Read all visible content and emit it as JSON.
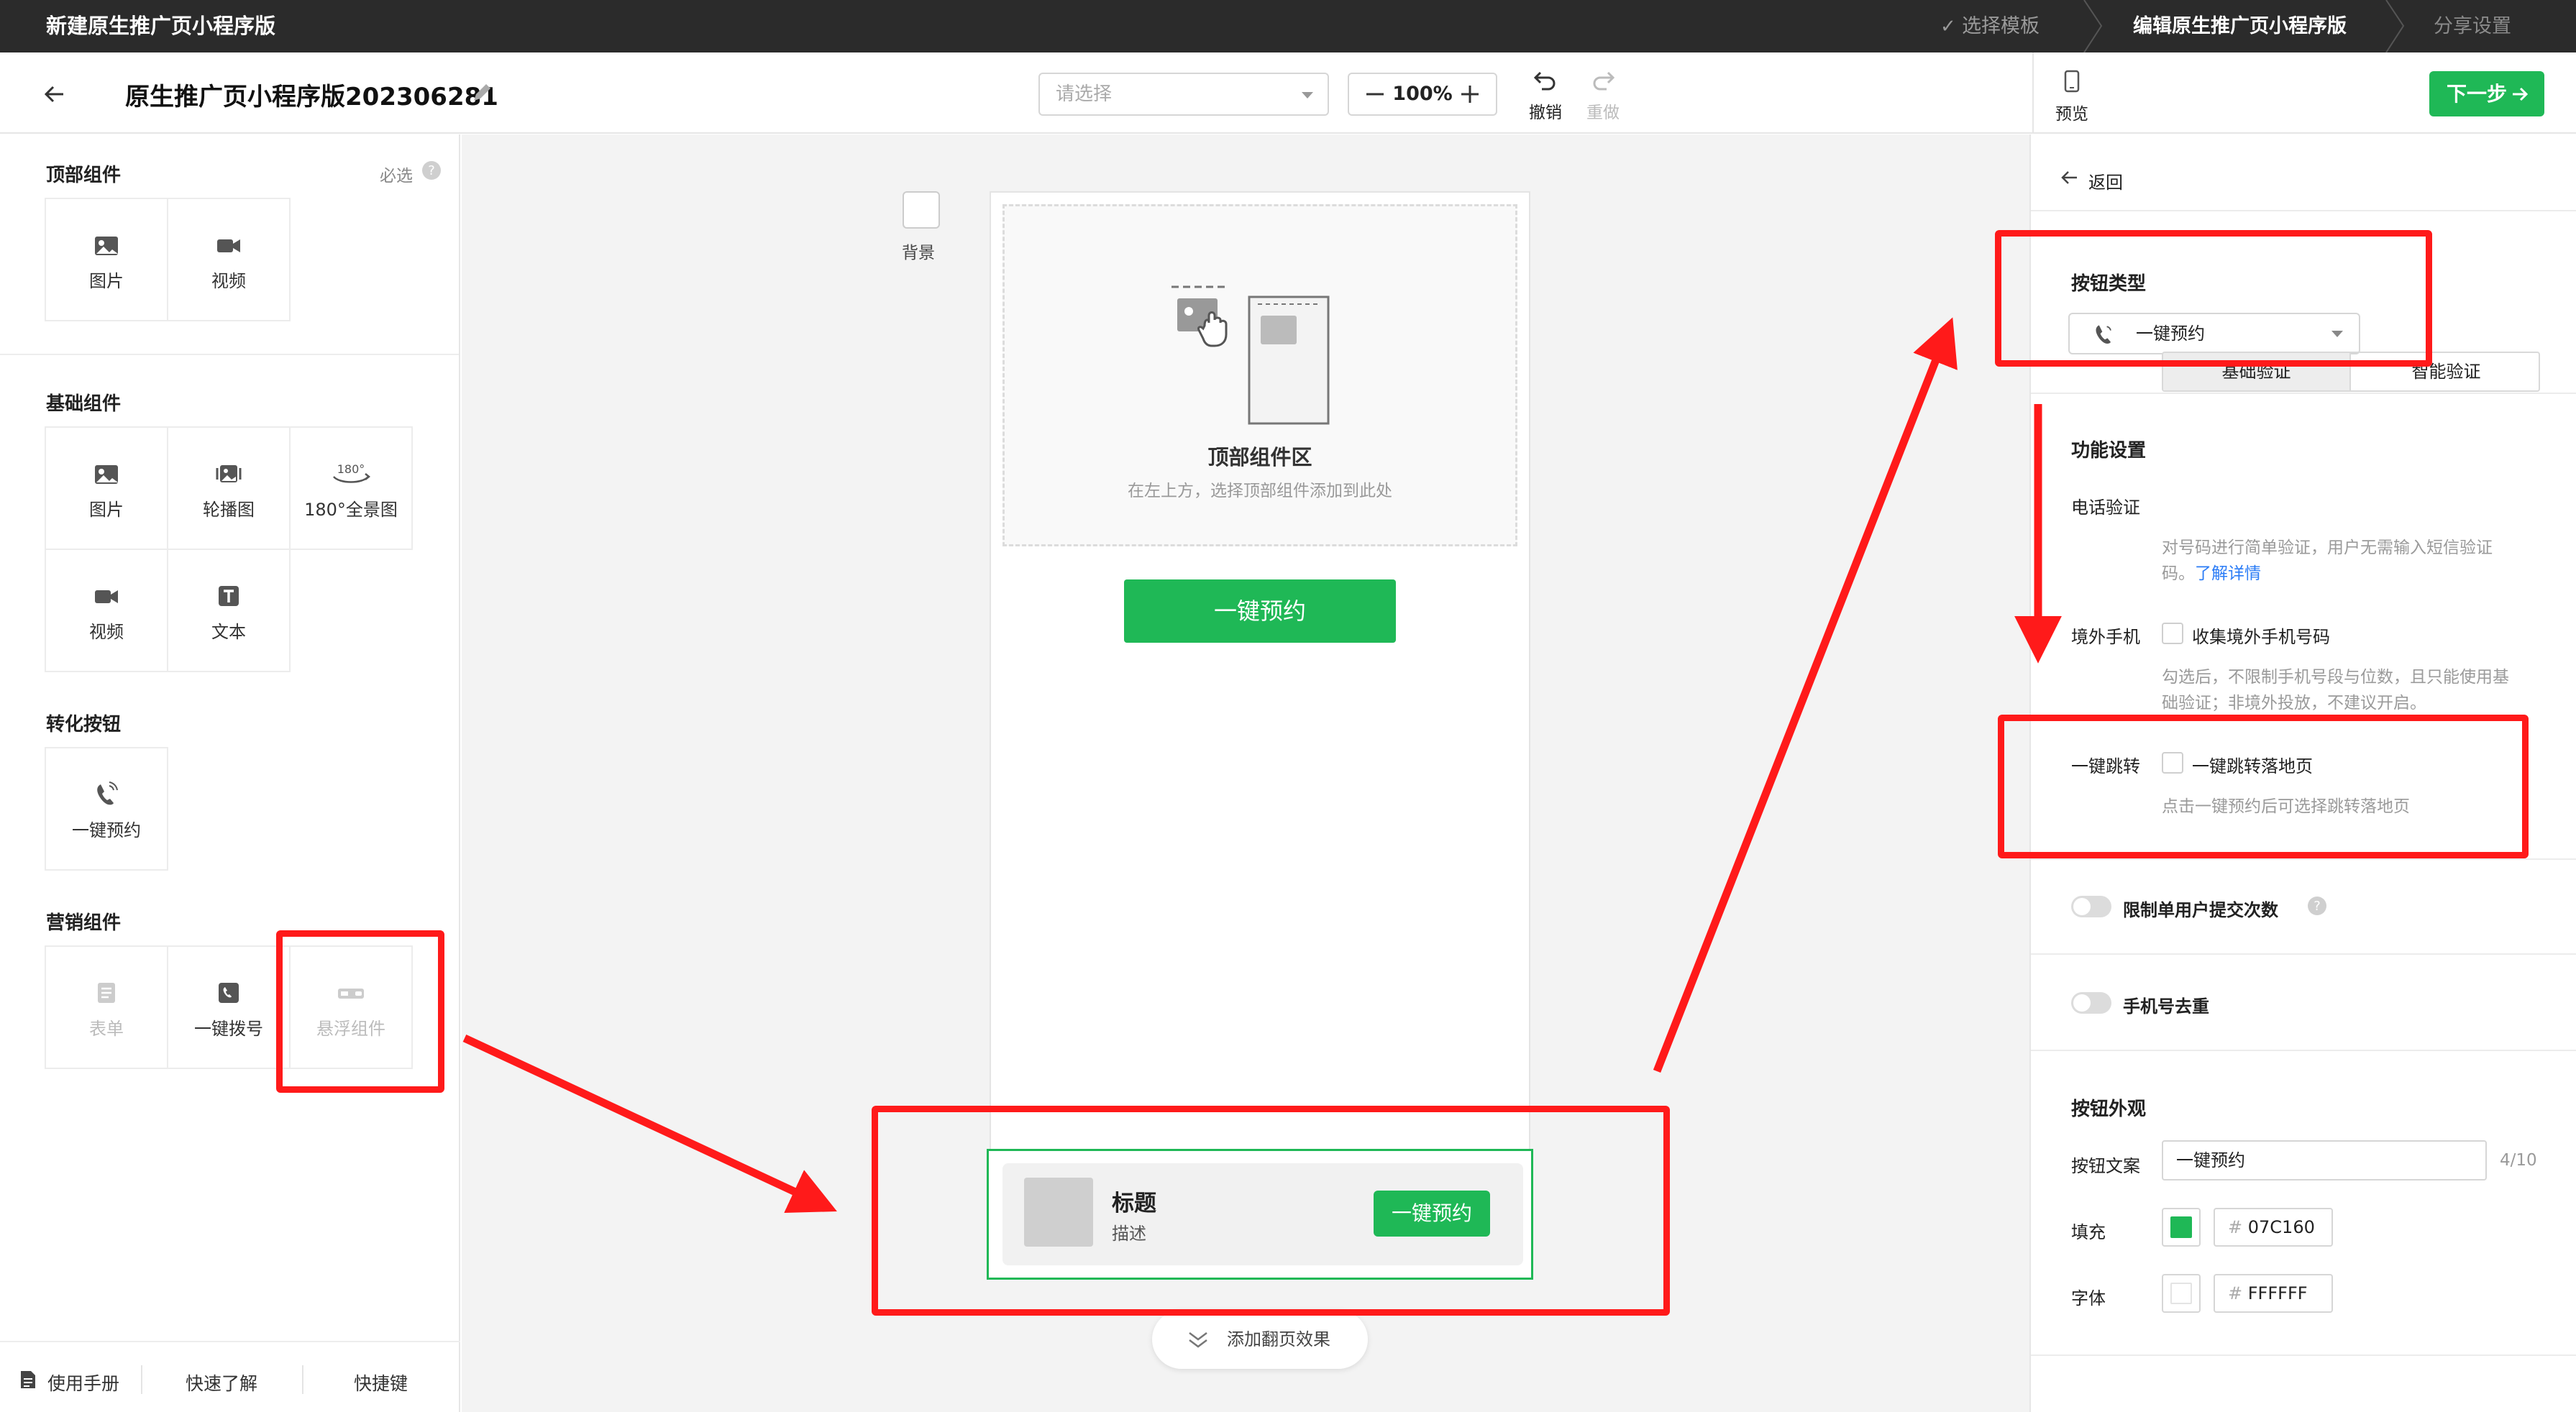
{
  "topbar": {
    "title": "新建原生推广页小程序版",
    "steps": [
      "选择模板",
      "编辑原生推广页小程序版",
      "分享设置"
    ]
  },
  "toolbar": {
    "page_name": "原生推广页小程序版202306281",
    "select_placeholder": "请选择",
    "zoom": "100%",
    "undo": "撤销",
    "redo": "重做",
    "preview": "预览",
    "next": "下一步"
  },
  "left": {
    "top_section": "顶部组件",
    "required": "必选",
    "top_items": [
      "图片",
      "视频"
    ],
    "basic_section": "基础组件",
    "basic_items": [
      "图片",
      "轮播图",
      "180°全景图",
      "视频",
      "文本"
    ],
    "panorama_badge": "180°",
    "convert_section": "转化按钮",
    "convert_items": [
      "一键预约"
    ],
    "marketing_section": "营销组件",
    "marketing_items": [
      "表单",
      "一键拨号",
      "悬浮组件"
    ],
    "bottom_links": [
      "使用手册",
      "快速了解",
      "快捷键"
    ]
  },
  "canvas": {
    "bg_label": "背景",
    "top_zone_title": "顶部组件区",
    "top_zone_hint": "在左上方，选择顶部组件添加到此处",
    "cta_label": "一键预约",
    "float_title": "标题",
    "float_desc": "描述",
    "float_btn": "一键预约",
    "flip_label": "添加翻页效果"
  },
  "right": {
    "back": "返回",
    "btn_type_title": "按钮类型",
    "btn_type_value": "一键预约",
    "func_title": "功能设置",
    "phone_verify_label": "电话验证",
    "phone_verify_options": [
      "基础验证",
      "智能验证"
    ],
    "phone_verify_help": "对号码进行简单验证，用户无需输入短信验证",
    "phone_verify_help2": "码。",
    "learn_more": "了解详情",
    "overseas_label": "境外手机",
    "overseas_checkbox": "收集境外手机号码",
    "overseas_help": "勾选后，不限制手机号段与位数，且只能使用基",
    "overseas_help2": "础验证；非境外投放，不建议开启。",
    "jump_label": "一键跳转",
    "jump_checkbox": "一键跳转落地页",
    "jump_help": "点击一键预约后可选择跳转落地页",
    "limit_toggle": "限制单用户提交次数",
    "dedupe_toggle": "手机号去重",
    "appearance_title": "按钮外观",
    "text_label": "按钮文案",
    "text_value": "一键预约",
    "text_count": "4/10",
    "fill_label": "填充",
    "fill_hash": "#",
    "fill_value": "07C160",
    "font_label": "字体",
    "font_hash": "#",
    "font_value": "FFFFFF"
  },
  "colors": {
    "accent": "#1fb856",
    "fill_swatch": "#07C160",
    "font_swatch": "#FFFFFF",
    "annotation": "#ff1a1a"
  }
}
